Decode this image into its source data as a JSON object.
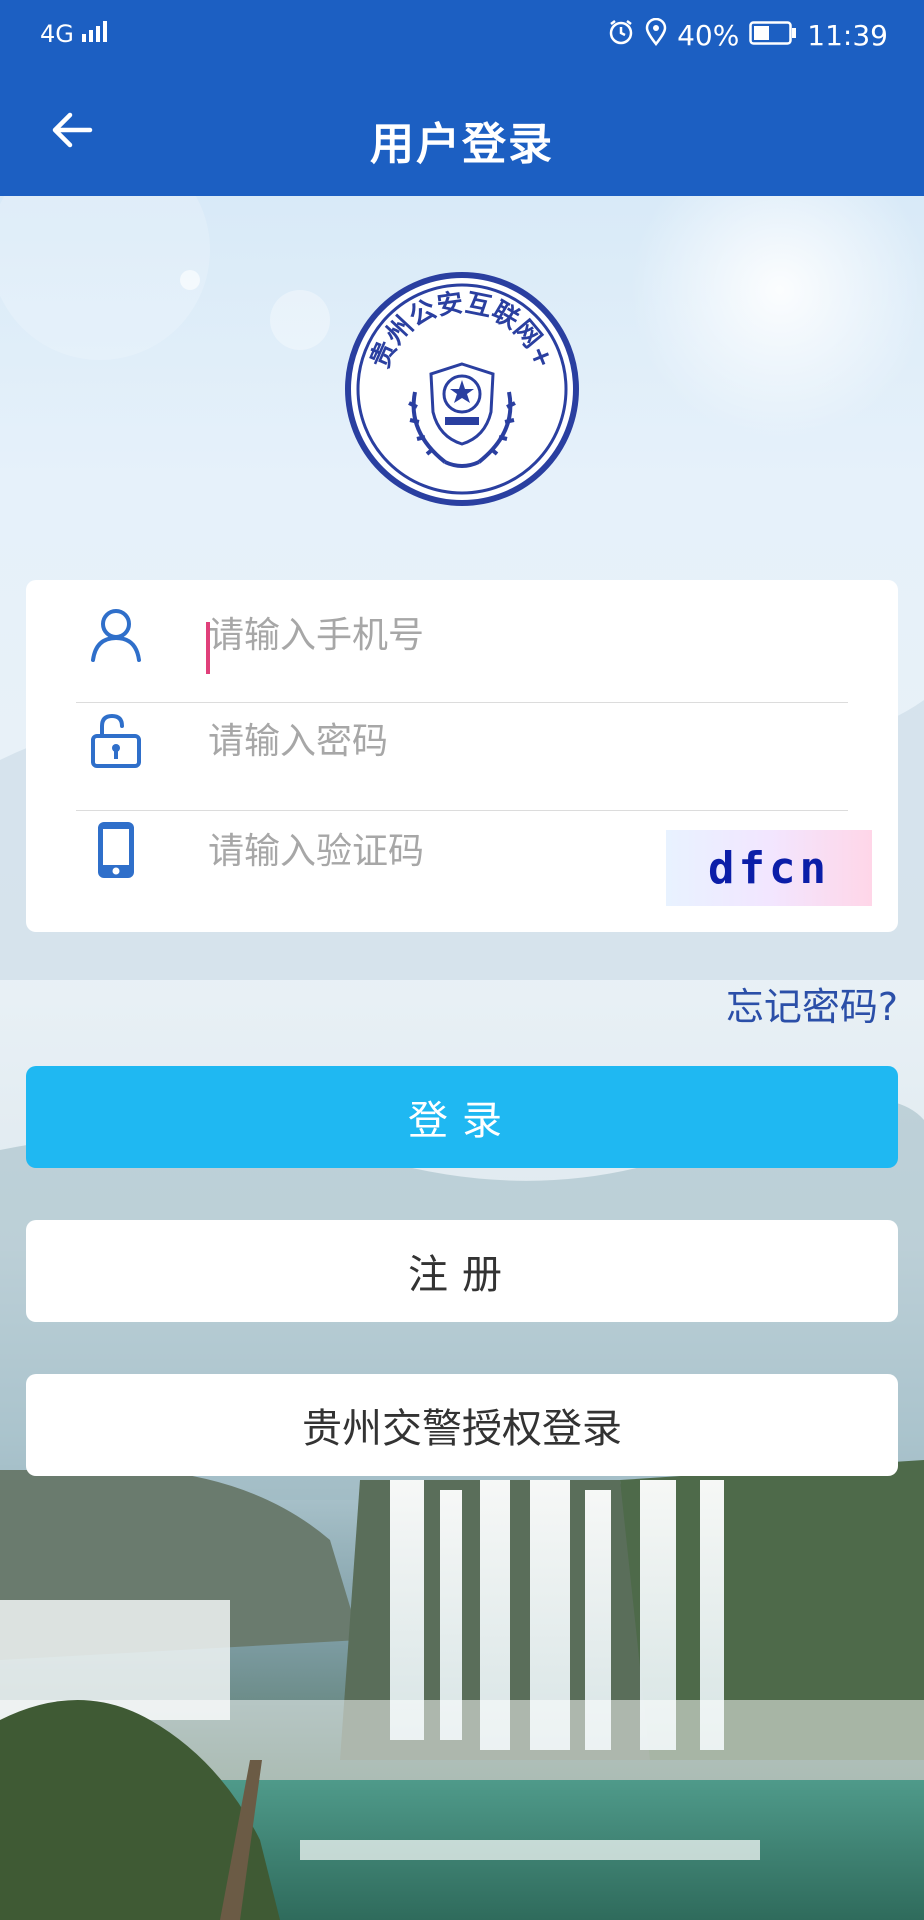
{
  "status_bar": {
    "network": "4G",
    "battery": "40%",
    "time": "11:39"
  },
  "header": {
    "title": "用户登录"
  },
  "emblem": {
    "text": "贵州公安互联网+"
  },
  "form": {
    "phone_placeholder": "请输入手机号",
    "password_placeholder": "请输入密码",
    "code_placeholder": "请输入验证码",
    "captcha_text": "dfcn"
  },
  "links": {
    "forgot_password": "忘记密码?"
  },
  "buttons": {
    "login": "登录",
    "register": "注册",
    "auth_login": "贵州交警授权登录"
  },
  "colors": {
    "primary": "#1c5fc2",
    "login_button": "#1fb8f2",
    "icon": "#2f6fca",
    "captcha_text": "#0b1ea8"
  }
}
